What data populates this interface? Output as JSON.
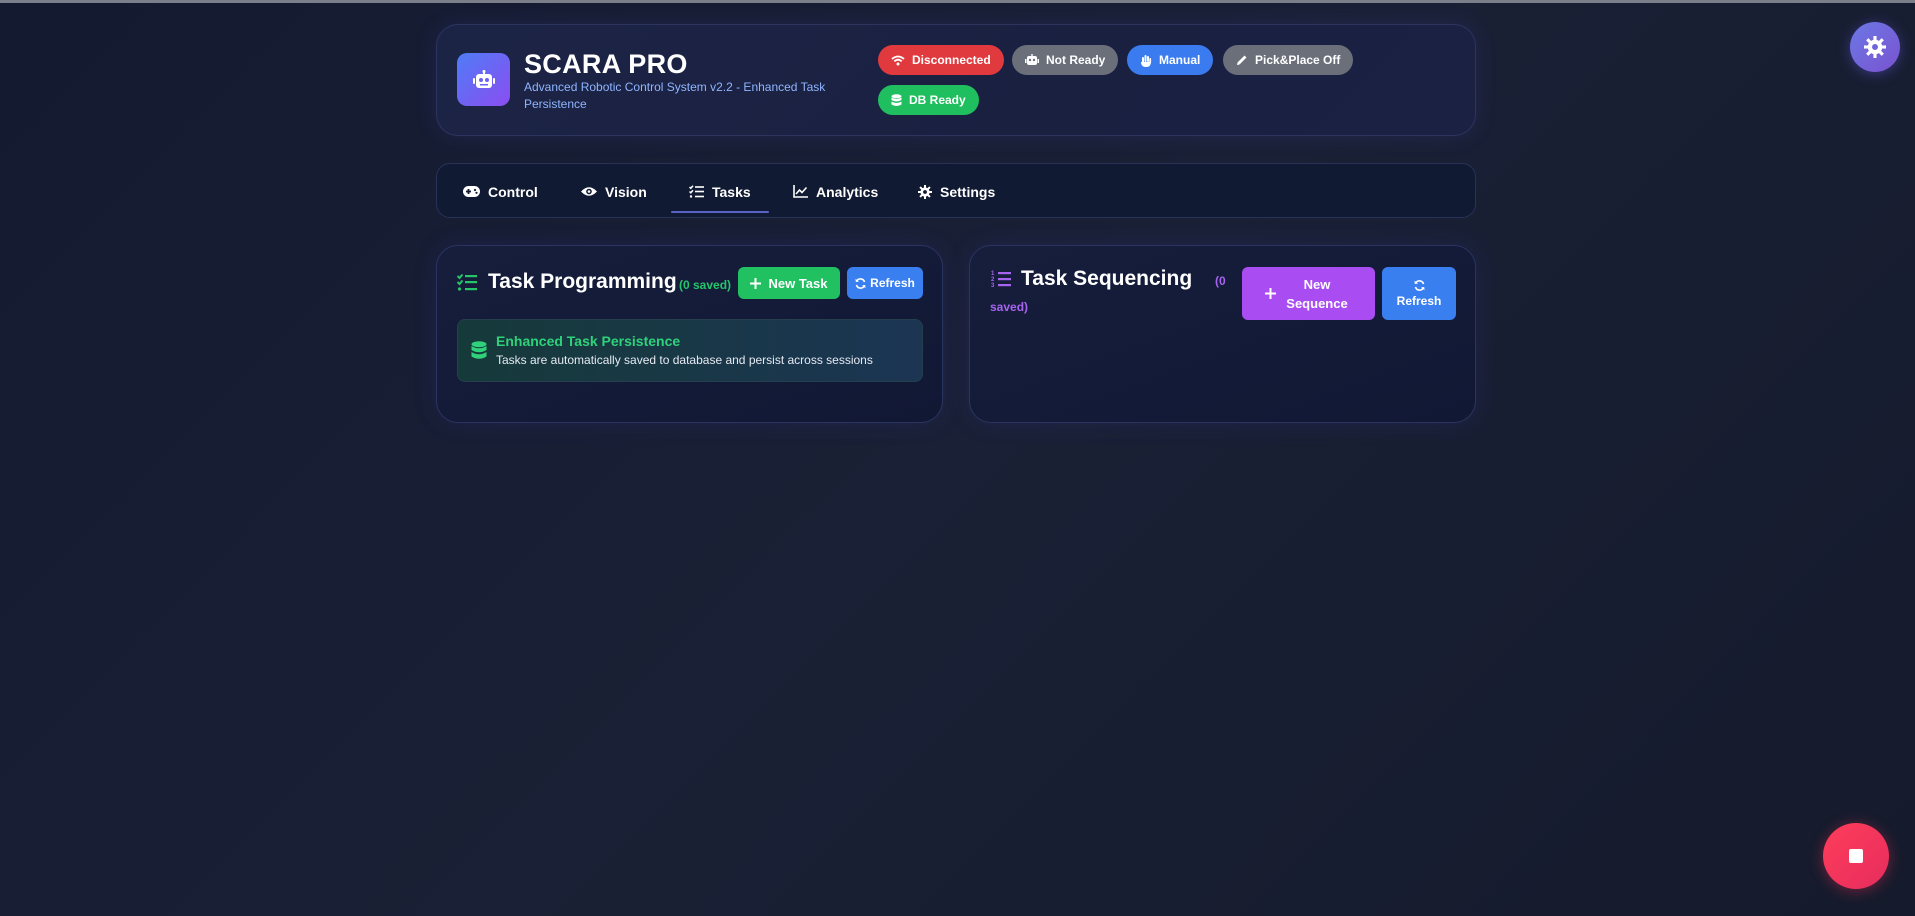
{
  "header": {
    "title": "SCARA PRO",
    "subtitle": "Advanced Robotic Control System v2.2 - Enhanced Task Persistence",
    "badges": {
      "connection": "Disconnected",
      "ready": "Not Ready",
      "mode": "Manual",
      "pickplace": "Pick&Place Off",
      "db": "DB Ready"
    }
  },
  "nav": {
    "tabs": [
      "Control",
      "Vision",
      "Tasks",
      "Analytics",
      "Settings"
    ],
    "active": "Tasks"
  },
  "task_programming": {
    "title": "Task Programming",
    "saved": "(0 saved)",
    "new_label": "New Task",
    "refresh_label": "Refresh",
    "info_title": "Enhanced Task Persistence",
    "info_text": "Tasks are automatically saved to database and persist across sessions"
  },
  "task_sequencing": {
    "title": "Task Sequencing",
    "saved": "(0 saved)",
    "new_label": "New Sequence",
    "refresh_label": "Refresh"
  },
  "colors": {
    "background": "#151b2c",
    "danger": "#e03a3e",
    "success": "#1fbe5e",
    "primary": "#3a7cf0",
    "purple": "#a94df2"
  },
  "icons": [
    "robot-icon",
    "wifi-icon",
    "hand-icon",
    "pencil-icon",
    "database-icon",
    "gamepad-icon",
    "eye-icon",
    "tasks-icon",
    "chart-line-icon",
    "gear-icon",
    "plus-icon",
    "sync-icon",
    "list-ol-icon",
    "stop-icon"
  ]
}
